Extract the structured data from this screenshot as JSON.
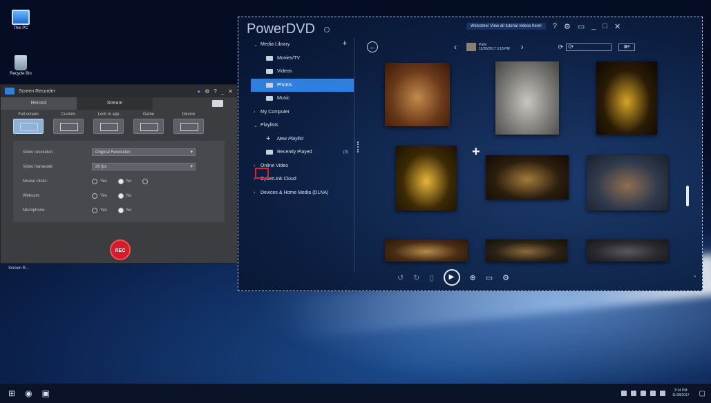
{
  "desktop": {
    "icons": [
      {
        "label": "This PC",
        "icon": "computer-icon"
      },
      {
        "label": "Recycle Bin",
        "icon": "recycle-bin-icon"
      }
    ],
    "recorder_caption": "Screen R..."
  },
  "recorder": {
    "title": "Screen Recorder",
    "tabs": [
      "Record",
      "Stream"
    ],
    "modes": [
      "Full screen",
      "Custom",
      "Lock to app",
      "Game",
      "Device"
    ],
    "settings": {
      "video_resolution_label": "Video resolution:",
      "video_resolution_value": "Original Resolution",
      "video_framerate_label": "Video framerate:",
      "video_framerate_value": "30 fps",
      "mouse_clicks_label": "Mouse clicks:",
      "webcam_label": "Webcam:",
      "microphone_label": "Microphone:",
      "yes": "Yes",
      "no": "No"
    },
    "rec_label": "REC"
  },
  "powerdvd": {
    "brand": "PowerDVD",
    "tutorial_banner": "Welcome! View all tutorial videos here!",
    "album_name": "Paris",
    "album_date": "11/20/2017 3:18 PM",
    "search_placeholder": "Q▾",
    "sidebar": {
      "media_library": "Media Library",
      "movies_tv": "Movies/TV",
      "videos": "Videos",
      "photos": "Photos",
      "music": "Music",
      "my_computer": "My Computer",
      "playlists": "Playlists",
      "new_playlist": "New Playlist",
      "recently_played": "Recently Played",
      "recently_played_count": "(0)",
      "online_video": "Online Video",
      "cyberlink_cloud": "CyberLink Cloud",
      "devices": "Devices & Home Media (DLNA)"
    },
    "photos": [
      {
        "name": "photo-cafe",
        "colors": [
          "#6b3a1a",
          "#c28a4c",
          "#3a1a08"
        ]
      },
      {
        "name": "photo-stone-building",
        "colors": [
          "#7c7b78",
          "#c9c6bf",
          "#45443f"
        ]
      },
      {
        "name": "photo-eiffel-night",
        "colors": [
          "#2a1b05",
          "#d5a427",
          "#0d0800"
        ]
      },
      {
        "name": "photo-eiffel-lit",
        "colors": [
          "#3d2a05",
          "#e7b53a",
          "#1c1200"
        ]
      },
      {
        "name": "photo-pilier-nord",
        "colors": [
          "#2c1e0e",
          "#a37a3a",
          "#120a04"
        ]
      },
      {
        "name": "photo-woman-night",
        "colors": [
          "#2f3a4c",
          "#8f6d51",
          "#1b1f29"
        ]
      },
      {
        "name": "photo-indoor",
        "colors": [
          "#4a2d12",
          "#b4894e",
          "#2a1608"
        ]
      },
      {
        "name": "photo-street",
        "colors": [
          "#2b2216",
          "#8a6a3c",
          "#140f08"
        ]
      },
      {
        "name": "photo-dusk",
        "colors": [
          "#2a2a2e",
          "#57575c",
          "#18181c"
        ]
      }
    ]
  },
  "taskbar": {
    "clock_time": "3:14 PM",
    "clock_date": "11/28/2017"
  }
}
